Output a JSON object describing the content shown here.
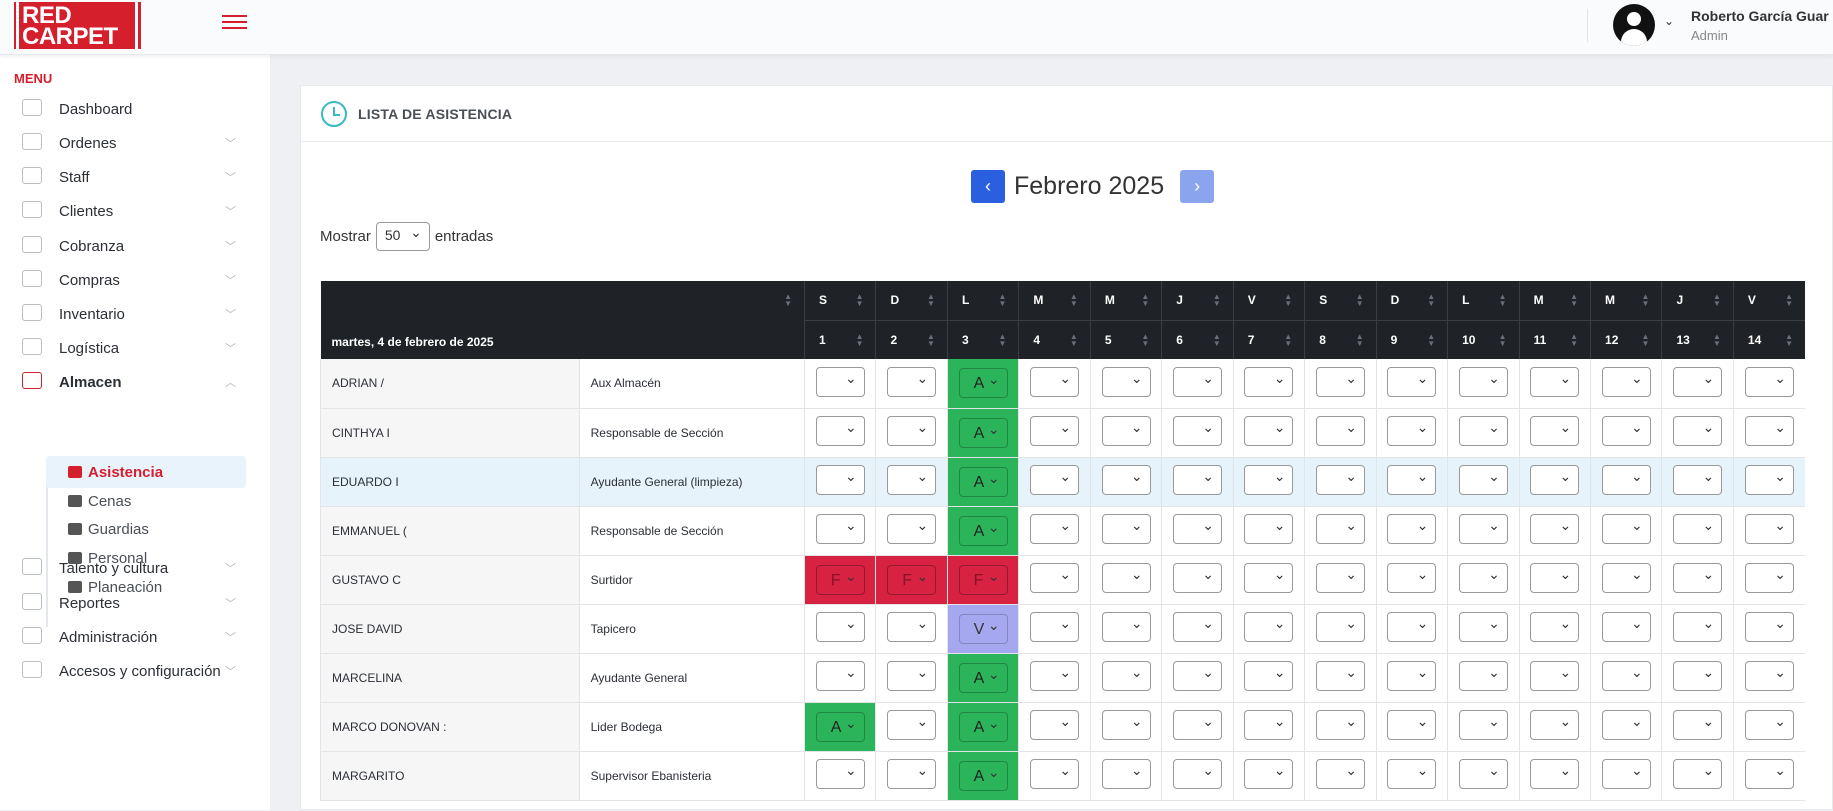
{
  "header": {
    "logo_line1": "RED",
    "logo_line2": "CARPET",
    "user_name": "Roberto García Guar",
    "user_role": "Admin"
  },
  "sidebar": {
    "menu_title": "MENU",
    "items": [
      {
        "label": "Dashboard",
        "icon": "dashboard-icon",
        "chevron": false
      },
      {
        "label": "Ordenes",
        "icon": "orders-icon",
        "chevron": true
      },
      {
        "label": "Staff",
        "icon": "staff-icon",
        "chevron": true
      },
      {
        "label": "Clientes",
        "icon": "clients-icon",
        "chevron": true
      },
      {
        "label": "Cobranza",
        "icon": "billing-icon",
        "chevron": true
      },
      {
        "label": "Compras",
        "icon": "purchases-icon",
        "chevron": true
      },
      {
        "label": "Inventario",
        "icon": "inventory-icon",
        "chevron": true
      },
      {
        "label": "Logística",
        "icon": "logistics-icon",
        "chevron": true
      },
      {
        "label": "Almacen",
        "icon": "warehouse-icon",
        "chevron": true,
        "expanded": true
      },
      {
        "label": "Talento y cultura",
        "icon": "talent-icon",
        "chevron": true
      },
      {
        "label": "Reportes",
        "icon": "reports-icon",
        "chevron": true
      },
      {
        "label": "Administración",
        "icon": "admin-icon",
        "chevron": true
      },
      {
        "label": "Accesos y configuración",
        "icon": "settings-icon",
        "chevron": true
      }
    ],
    "subitems": [
      {
        "label": "Asistencia",
        "icon": "user-check-icon",
        "active": true
      },
      {
        "label": "Cenas",
        "icon": "utensils-icon",
        "active": false
      },
      {
        "label": "Guardias",
        "icon": "truck-icon",
        "active": false
      },
      {
        "label": "Personal",
        "icon": "users-icon",
        "active": false
      },
      {
        "label": "Planeación",
        "icon": "calendar-icon",
        "active": false
      }
    ]
  },
  "card": {
    "title": "LISTA DE ASISTENCIA",
    "month_title": "Febrero 2025",
    "show_label": "Mostrar",
    "show_value": "50",
    "entries_label": "entradas"
  },
  "table": {
    "date_header": "martes, 4 de febrero de 2025",
    "days": [
      "S",
      "D",
      "L",
      "M",
      "M",
      "J",
      "V",
      "S",
      "D",
      "L",
      "M",
      "M",
      "J",
      "V"
    ],
    "nums": [
      "1",
      "2",
      "3",
      "4",
      "5",
      "6",
      "7",
      "8",
      "9",
      "10",
      "11",
      "12",
      "13",
      "14"
    ],
    "rows": [
      {
        "name": "ADRIAN /",
        "role": "Aux Almacén",
        "cells": [
          "",
          "",
          "A",
          "",
          "",
          "",
          "",
          "",
          "",
          "",
          "",
          "",
          "",
          ""
        ]
      },
      {
        "name": "CINTHYA I",
        "role": "Responsable de Sección",
        "cells": [
          "",
          "",
          "A",
          "",
          "",
          "",
          "",
          "",
          "",
          "",
          "",
          "",
          "",
          ""
        ]
      },
      {
        "name": "EDUARDO I",
        "role": "Ayudante General (limpieza)",
        "cells": [
          "",
          "",
          "A",
          "",
          "",
          "",
          "",
          "",
          "",
          "",
          "",
          "",
          "",
          ""
        ],
        "highlight": true
      },
      {
        "name": "EMMANUEL (",
        "role": "Responsable de Sección",
        "cells": [
          "",
          "",
          "A",
          "",
          "",
          "",
          "",
          "",
          "",
          "",
          "",
          "",
          "",
          ""
        ]
      },
      {
        "name": "GUSTAVO C",
        "role": "Surtidor",
        "cells": [
          "F",
          "F",
          "F",
          "",
          "",
          "",
          "",
          "",
          "",
          "",
          "",
          "",
          "",
          ""
        ]
      },
      {
        "name": "JOSE DAVID",
        "role": "Tapicero",
        "cells": [
          "",
          "",
          "V",
          "",
          "",
          "",
          "",
          "",
          "",
          "",
          "",
          "",
          "",
          ""
        ]
      },
      {
        "name": "MARCELINA",
        "role": "Ayudante General",
        "cells": [
          "",
          "",
          "A",
          "",
          "",
          "",
          "",
          "",
          "",
          "",
          "",
          "",
          "",
          ""
        ]
      },
      {
        "name": "MARCO DONOVAN :",
        "role": "Lider Bodega",
        "cells": [
          "A",
          "",
          "A",
          "",
          "",
          "",
          "",
          "",
          "",
          "",
          "",
          "",
          "",
          ""
        ]
      },
      {
        "name": "MARGARITO",
        "role": "Supervisor Ebanisteria",
        "cells": [
          "",
          "",
          "A",
          "",
          "",
          "",
          "",
          "",
          "",
          "",
          "",
          "",
          "",
          ""
        ]
      }
    ]
  },
  "colors": {
    "brand": "#d51f2d",
    "present": "#2bb45a",
    "absent": "#d72242",
    "vacation": "#a5a8ef",
    "nav_prev": "#2a5fe0",
    "nav_next": "#8aa4ee"
  }
}
